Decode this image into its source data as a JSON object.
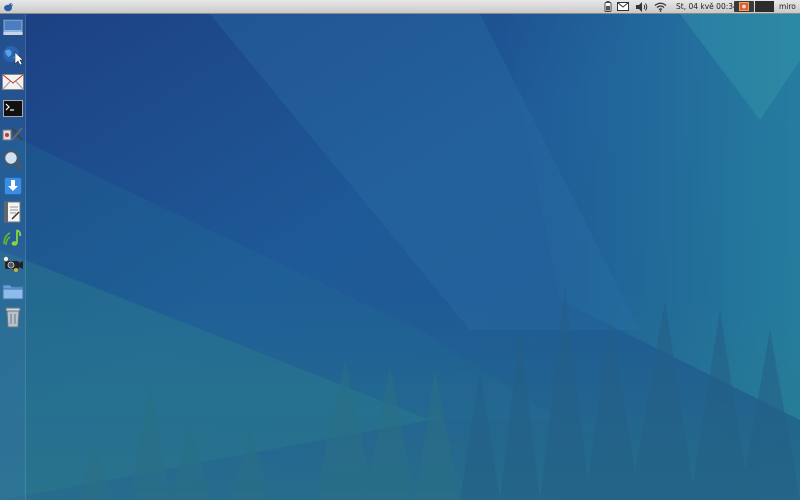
{
  "top_panel": {
    "app_menu_icon": "xfce-mouse-icon",
    "tray_icons": [
      "battery-icon",
      "mail-icon",
      "volume-icon",
      "wifi-icon"
    ],
    "clock": "St, 04 kvě  00:34",
    "user": "miro"
  },
  "dock": {
    "launchers": [
      "desktop-icon",
      "web-browser-icon",
      "mail-client-icon",
      "terminal-icon",
      "settings-icon",
      "search-icon",
      "download-icon",
      "text-editor-icon",
      "music-player-icon",
      "video-player-icon",
      "folder-icon",
      "trash-icon"
    ]
  },
  "colors": {
    "wallpaper_dark": "#1b3f7a",
    "wallpaper_teal": "#2a8aa2",
    "panel": "#d6d6d6"
  }
}
